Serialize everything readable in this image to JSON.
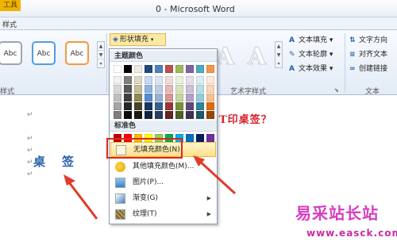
{
  "titlebar": {
    "active_tab": "工具",
    "title": "0  -  Microsoft Word"
  },
  "tabs": {
    "first": "样式"
  },
  "ribbon": {
    "shape_styles": [
      "Abc",
      "Abc",
      "Abc"
    ],
    "shape_styles_label": "样式",
    "fill_button": "形状填充",
    "wordart_label": "艺术字样式",
    "wordart_sample": "A",
    "text_fill": "文本填充",
    "text_outline": "文本轮廓",
    "text_effect": "文本效果",
    "text_dir": "文字方向",
    "align_text": "对齐文本",
    "create_link": "创建链接",
    "text_group_label": "文本"
  },
  "menu": {
    "theme_colors_label": "主题颜色",
    "standard_colors_label": "标准色",
    "theme_colors": [
      [
        "#ffffff",
        "#000000",
        "#eeece1",
        "#1f497d",
        "#4f81bd",
        "#c0504d",
        "#9bbb59",
        "#8064a2",
        "#4bacc6",
        "#f79646"
      ],
      [
        "#f2f2f2",
        "#7f7f7f",
        "#ddd9c3",
        "#c6d9f0",
        "#dbe5f1",
        "#f2dcdb",
        "#ebf1dd",
        "#e5e0ec",
        "#dbeef3",
        "#fdeada"
      ],
      [
        "#d8d8d8",
        "#595959",
        "#c4bd97",
        "#8db3e2",
        "#b8cce4",
        "#e5b9b7",
        "#d7e3bc",
        "#ccc1d9",
        "#b7dde8",
        "#fbd5b5"
      ],
      [
        "#bfbfbf",
        "#3f3f3f",
        "#938953",
        "#548dd4",
        "#95b3d7",
        "#d99694",
        "#c3d69b",
        "#b2a2c7",
        "#92cddc",
        "#fac08f"
      ],
      [
        "#a5a5a5",
        "#262626",
        "#494429",
        "#17365d",
        "#366092",
        "#953734",
        "#76923c",
        "#5f497a",
        "#31859b",
        "#e36c09"
      ],
      [
        "#7f7f7f",
        "#0c0c0c",
        "#1d1b10",
        "#0f243e",
        "#244061",
        "#632423",
        "#4f6128",
        "#3f3151",
        "#205867",
        "#974806"
      ]
    ],
    "standard_colors": [
      "#c00000",
      "#ff0000",
      "#ffc000",
      "#ffff00",
      "#92d050",
      "#00b050",
      "#00b0f0",
      "#0070c0",
      "#002060",
      "#7030a0"
    ],
    "items": [
      {
        "label": "无填充颜色(N)",
        "icon": "no-fill-icon"
      },
      {
        "label": "其他填充颜色(M)...",
        "icon": "palette-icon"
      },
      {
        "label": "图片(P)...",
        "icon": "picture-icon"
      },
      {
        "label": "渐变(G)",
        "icon": "gradient-icon"
      },
      {
        "label": "纹理(T)",
        "icon": "texture-icon"
      }
    ]
  },
  "document": {
    "header_text": "T印桌签？",
    "zhuo": "桌",
    "qian": "签",
    "para_mark": "↵"
  },
  "watermark": {
    "text": "易采站长站",
    "url": "www.easck.com"
  },
  "colors": {
    "accent_red": "#e0251d",
    "highlight": "#ffe08a",
    "word_blue": "#2a62a8"
  }
}
